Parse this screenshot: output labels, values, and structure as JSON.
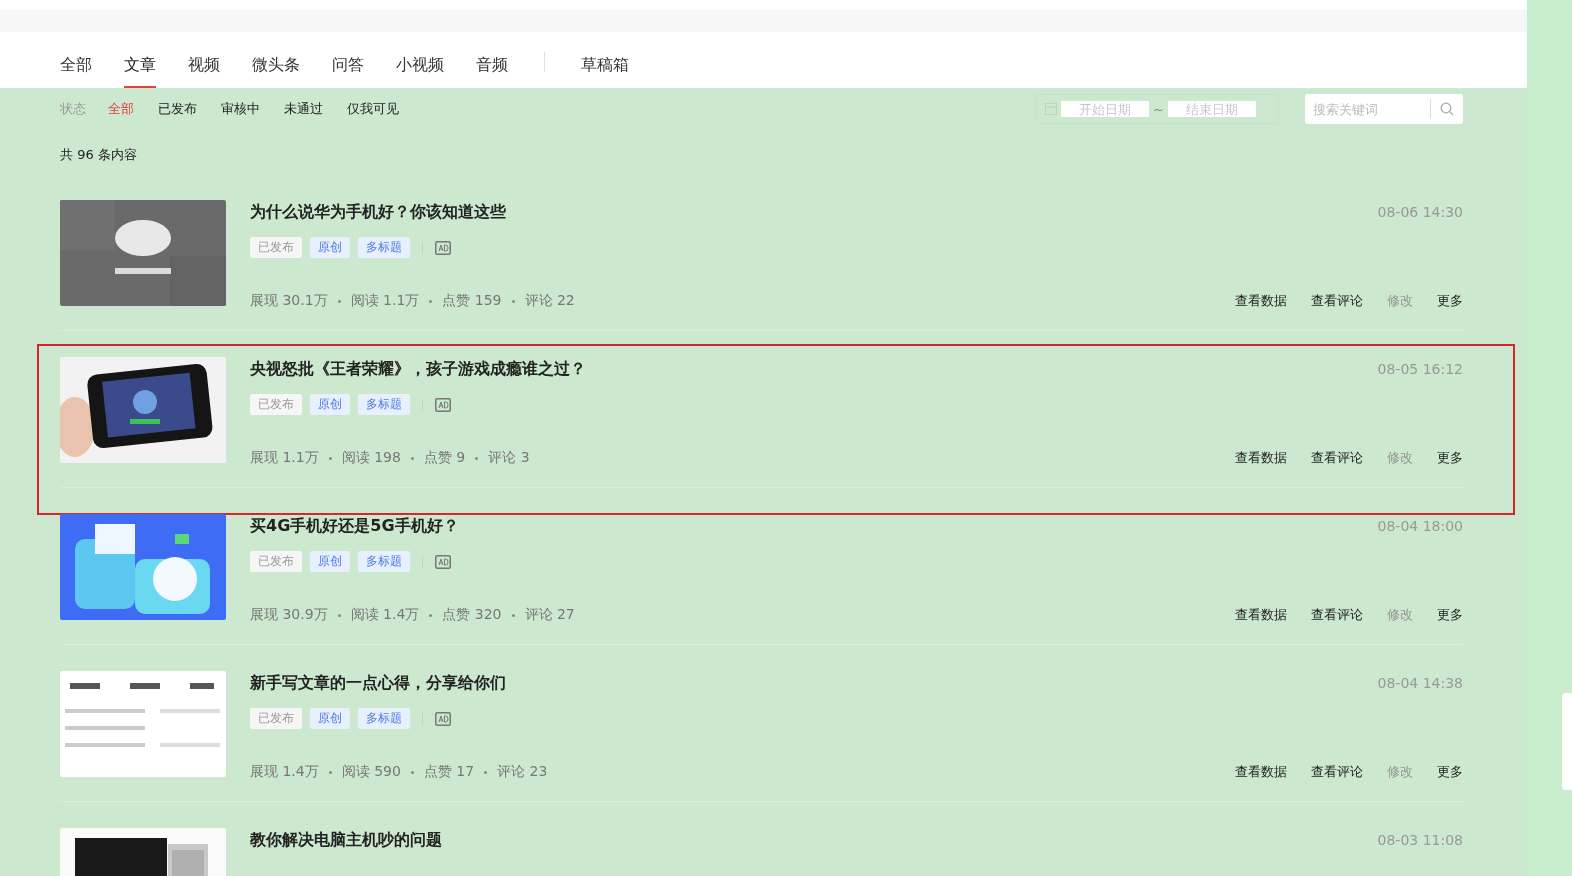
{
  "tabs": [
    {
      "label": "全部",
      "selected": false
    },
    {
      "label": "文章",
      "selected": true
    },
    {
      "label": "视频",
      "selected": false
    },
    {
      "label": "微头条",
      "selected": false
    },
    {
      "label": "问答",
      "selected": false
    },
    {
      "label": "小视频",
      "selected": false
    },
    {
      "label": "音频",
      "selected": false
    }
  ],
  "drafts_tab": {
    "label": "草稿箱",
    "selected": false
  },
  "filters": {
    "label": "状态",
    "options": [
      {
        "label": "全部",
        "selected": true
      },
      {
        "label": "已发布",
        "selected": false
      },
      {
        "label": "审核中",
        "selected": false
      },
      {
        "label": "未通过",
        "selected": false
      },
      {
        "label": "仅我可见",
        "selected": false
      }
    ]
  },
  "date_range": {
    "start_placeholder": "开始日期",
    "separator": "~",
    "end_placeholder": "结束日期"
  },
  "search": {
    "placeholder": "搜索关键词"
  },
  "total": "共 96 条内容",
  "articles": [
    {
      "title": "为什么说华为手机好？你该知道这些",
      "date": "08-06 14:30",
      "highlighted": false,
      "tags": [
        {
          "kind": "status",
          "label": "已发布"
        },
        {
          "kind": "type",
          "label": "原创"
        },
        {
          "kind": "type",
          "label": "多标题"
        }
      ],
      "stats": [
        "展现 30.1万",
        "阅读 1.1万",
        "点赞 159",
        "评论 22"
      ],
      "actions": [
        {
          "label": "查看数据",
          "disabled": false
        },
        {
          "label": "查看评论",
          "disabled": false
        },
        {
          "label": "修改",
          "disabled": true
        },
        {
          "label": "更多",
          "disabled": false
        }
      ]
    },
    {
      "title": "央视怒批《王者荣耀》，孩子游戏成瘾谁之过？",
      "date": "08-05 16:12",
      "highlighted": true,
      "tags": [
        {
          "kind": "status",
          "label": "已发布"
        },
        {
          "kind": "type",
          "label": "原创"
        },
        {
          "kind": "type",
          "label": "多标题"
        }
      ],
      "stats": [
        "展现 1.1万",
        "阅读 198",
        "点赞 9",
        "评论 3"
      ],
      "actions": [
        {
          "label": "查看数据",
          "disabled": false
        },
        {
          "label": "查看评论",
          "disabled": false
        },
        {
          "label": "修改",
          "disabled": true
        },
        {
          "label": "更多",
          "disabled": false
        }
      ]
    },
    {
      "title": "买4G手机好还是5G手机好？",
      "date": "08-04 18:00",
      "highlighted": false,
      "tags": [
        {
          "kind": "status",
          "label": "已发布"
        },
        {
          "kind": "type",
          "label": "原创"
        },
        {
          "kind": "type",
          "label": "多标题"
        }
      ],
      "stats": [
        "展现 30.9万",
        "阅读 1.4万",
        "点赞 320",
        "评论 27"
      ],
      "actions": [
        {
          "label": "查看数据",
          "disabled": false
        },
        {
          "label": "查看评论",
          "disabled": false
        },
        {
          "label": "修改",
          "disabled": true
        },
        {
          "label": "更多",
          "disabled": false
        }
      ]
    },
    {
      "title": "新手写文章的一点心得，分享给你们",
      "date": "08-04 14:38",
      "highlighted": false,
      "tags": [
        {
          "kind": "status",
          "label": "已发布"
        },
        {
          "kind": "type",
          "label": "原创"
        },
        {
          "kind": "type",
          "label": "多标题"
        }
      ],
      "stats": [
        "展现 1.4万",
        "阅读 590",
        "点赞 17",
        "评论 23"
      ],
      "actions": [
        {
          "label": "查看数据",
          "disabled": false
        },
        {
          "label": "查看评论",
          "disabled": false
        },
        {
          "label": "修改",
          "disabled": true
        },
        {
          "label": "更多",
          "disabled": false
        }
      ]
    },
    {
      "title": "教你解决电脑主机吵的问题",
      "date": "08-03 11:08",
      "highlighted": false
    }
  ]
}
